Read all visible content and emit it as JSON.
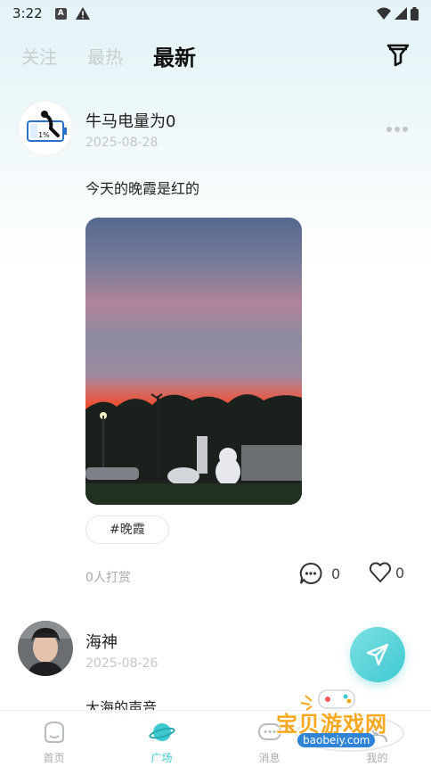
{
  "status_bar": {
    "time": "3:22",
    "app_badge": "A"
  },
  "tabs": [
    {
      "label": "关注"
    },
    {
      "label": "最热"
    },
    {
      "label": "最新",
      "active": true
    }
  ],
  "posts": [
    {
      "username": "牛马电量为0",
      "date": "2025-08-28",
      "text": "今天的晚霞是红的",
      "tag": "#晚霞",
      "tip_text": "0人打赏",
      "comments": "0",
      "likes": "0"
    },
    {
      "username": "海神",
      "date": "2025-08-26",
      "text": "大海的声音"
    }
  ],
  "bottom_nav": [
    {
      "label": "首页",
      "icon": "home-icon"
    },
    {
      "label": "广场",
      "icon": "planet-icon",
      "active": true
    },
    {
      "label": "消息",
      "icon": "message-icon"
    },
    {
      "label": "我的",
      "icon": "profile-icon"
    }
  ],
  "watermark": {
    "title": "宝贝游戏网",
    "url": "baobeiy.com"
  },
  "colors": {
    "accent": "#3ec9d1",
    "muted": "#c3c6c9",
    "watermark_orange": "#f7a81f"
  }
}
